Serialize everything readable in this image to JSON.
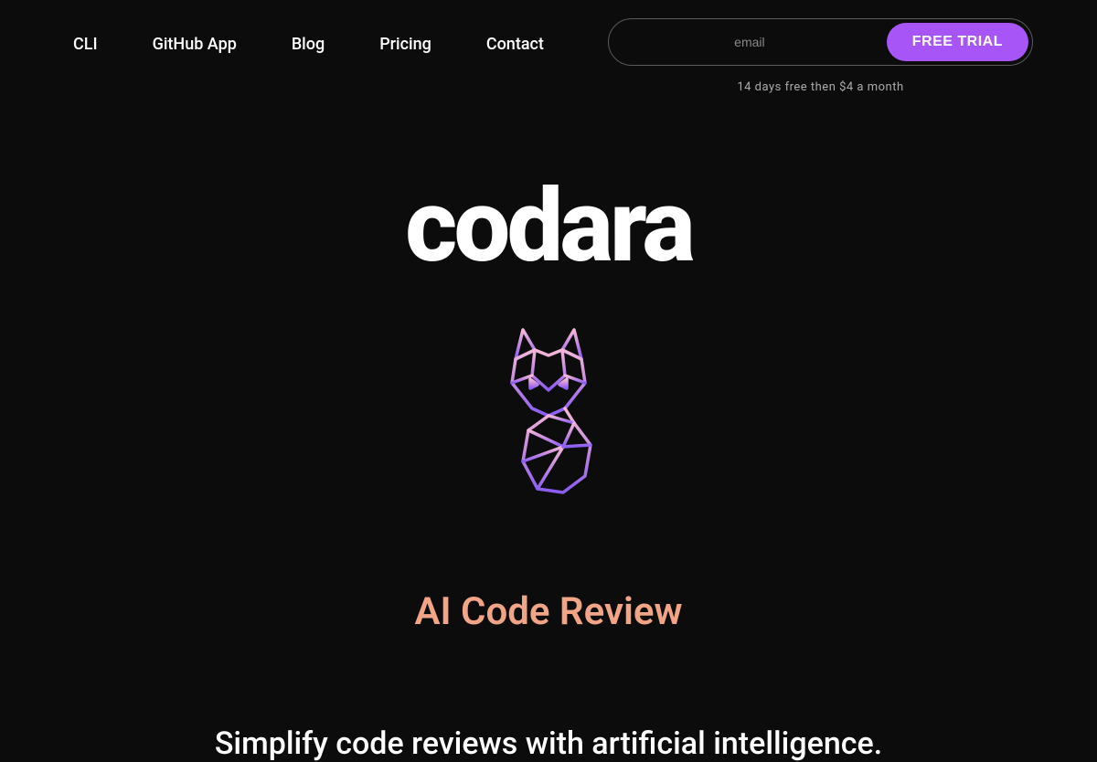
{
  "nav": {
    "items": [
      {
        "label": "CLI"
      },
      {
        "label": "GitHub App"
      },
      {
        "label": "Blog"
      },
      {
        "label": "Pricing"
      },
      {
        "label": "Contact"
      }
    ]
  },
  "signup": {
    "placeholder": "email",
    "cta": "FREE TRIAL",
    "fineprint": "14 days free then $4 a month"
  },
  "brand": {
    "name": "codara"
  },
  "hero": {
    "headline": "AI Code Review",
    "subhead": "Simplify code reviews with artificial intelligence."
  },
  "colors": {
    "accent": "#a855f7",
    "headline": "#f2a486"
  }
}
